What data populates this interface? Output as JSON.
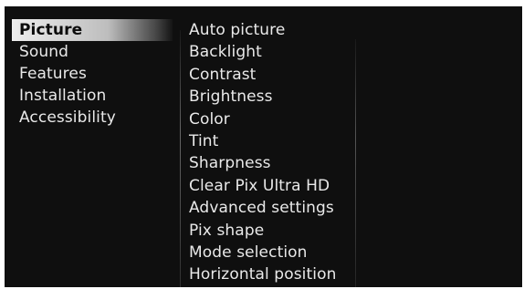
{
  "main_menu": {
    "items": [
      {
        "label": "Picture",
        "selected": true
      },
      {
        "label": "Sound",
        "selected": false
      },
      {
        "label": "Features",
        "selected": false
      },
      {
        "label": "Installation",
        "selected": false
      },
      {
        "label": "Accessibility",
        "selected": false
      }
    ]
  },
  "picture_submenu": {
    "items": [
      {
        "label": "Auto picture"
      },
      {
        "label": "Backlight"
      },
      {
        "label": "Contrast"
      },
      {
        "label": "Brightness"
      },
      {
        "label": "Color"
      },
      {
        "label": "Tint"
      },
      {
        "label": "Sharpness"
      },
      {
        "label": "Clear Pix Ultra HD"
      },
      {
        "label": "Advanced settings"
      },
      {
        "label": "Pix shape"
      },
      {
        "label": "Mode selection"
      },
      {
        "label": "Horizontal position"
      }
    ]
  },
  "colors": {
    "background": "#0f0f0f",
    "text": "#e9e9e9",
    "highlight_text": "#0c0c0c"
  }
}
